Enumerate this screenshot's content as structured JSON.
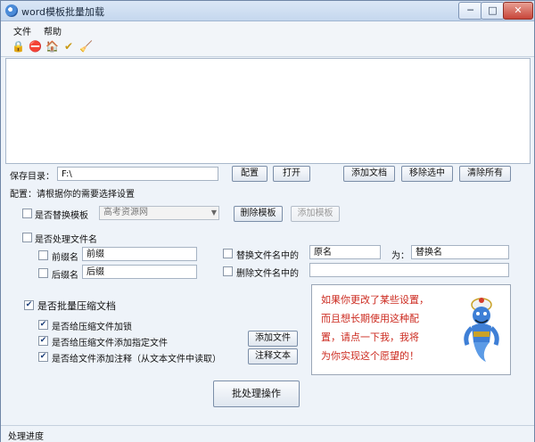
{
  "window": {
    "title": "word模板批量加载",
    "min_label": "─",
    "max_label": "□",
    "close_label": "✕"
  },
  "menu": {
    "items": [
      "文件",
      "帮助"
    ]
  },
  "toolbar": {
    "icons": [
      "lock-icon",
      "stop-icon",
      "home-icon",
      "check-icon",
      "broom-icon"
    ],
    "glyphs": [
      "🔒",
      "⛔",
      "🏠",
      "✔",
      "🧹"
    ]
  },
  "save_dir": {
    "label": "保存目录：",
    "value": "F:\\",
    "config_button": "配置",
    "open_button": "打开",
    "add_doc_button": "添加文档",
    "remove_selected_button": "移除选中",
    "clear_all_button": "清除所有"
  },
  "config_hint": "配置：请根据你的需要选择设置",
  "template": {
    "checkbox_label": "是否替换模板",
    "checked": false,
    "combo_value": "高考资源网",
    "delete_button": "删除模板",
    "add_button": "添加模板"
  },
  "filename": {
    "checkbox_label": "是否处理文件名",
    "checked": false,
    "prefix_label": "前缀名",
    "prefix_value": "前缀",
    "suffix_label": "后缀名",
    "suffix_value": "后缀",
    "replace_label": "替换文件名中的",
    "replace_from": "原名",
    "replace_as_label": "为：",
    "replace_to": "替换名",
    "delete_label": "删除文件名中的",
    "delete_value": ""
  },
  "compress": {
    "checkbox_label": "是否批量压缩文档",
    "checked": true,
    "opt_lock_label": "是否给压缩文件加锁",
    "opt_add_file_label": "是否给压缩文件添加指定文件",
    "opt_comment_label": "是否给文件添加注释（从文本文件中读取）",
    "add_file_button": "添加文件",
    "comment_button": "注释文本",
    "check_mark": "✔"
  },
  "tip": {
    "text": "如果你更改了某些设置，\n而且想长期使用这种配\n置，请点一下我，我将\n为你实现这个愿望的！"
  },
  "batch_button": "批处理操作",
  "status": {
    "label": "处理进度"
  },
  "colors": {
    "tip_text": "#cc2a1f",
    "window_bg": "#eef3f9"
  }
}
